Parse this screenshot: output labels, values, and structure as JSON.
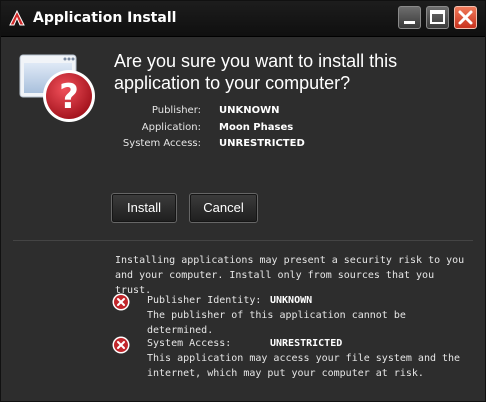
{
  "window": {
    "title": "Application Install"
  },
  "header": {
    "question": "Are you sure you want to install this application to your computer?"
  },
  "details": [
    {
      "label": "Publisher:",
      "value": "UNKNOWN"
    },
    {
      "label": "Application:",
      "value": "Moon Phases"
    },
    {
      "label": "System Access:",
      "value": "UNRESTRICTED"
    }
  ],
  "buttons": {
    "install": "Install",
    "cancel": "Cancel"
  },
  "warning": {
    "text": "Installing applications may present a security risk to you and your computer. Install only from sources that you trust."
  },
  "risks": [
    {
      "label": "Publisher Identity:",
      "value": "UNKNOWN",
      "description": "The publisher of this application cannot be determined."
    },
    {
      "label": "System Access:",
      "value": "UNRESTRICTED",
      "description": "This application may access your file system and the internet, which may put your computer at risk."
    }
  ],
  "colors": {
    "background": "#2d2d2d",
    "titlebar": "#111111",
    "close_button": "#d8452a",
    "risk_icon": "#c0262b",
    "question_icon": "#c8202a"
  },
  "icons": {
    "app_logo": "adobe-air-logo-icon",
    "install": "install-question-icon",
    "risk": "error-x-icon"
  }
}
